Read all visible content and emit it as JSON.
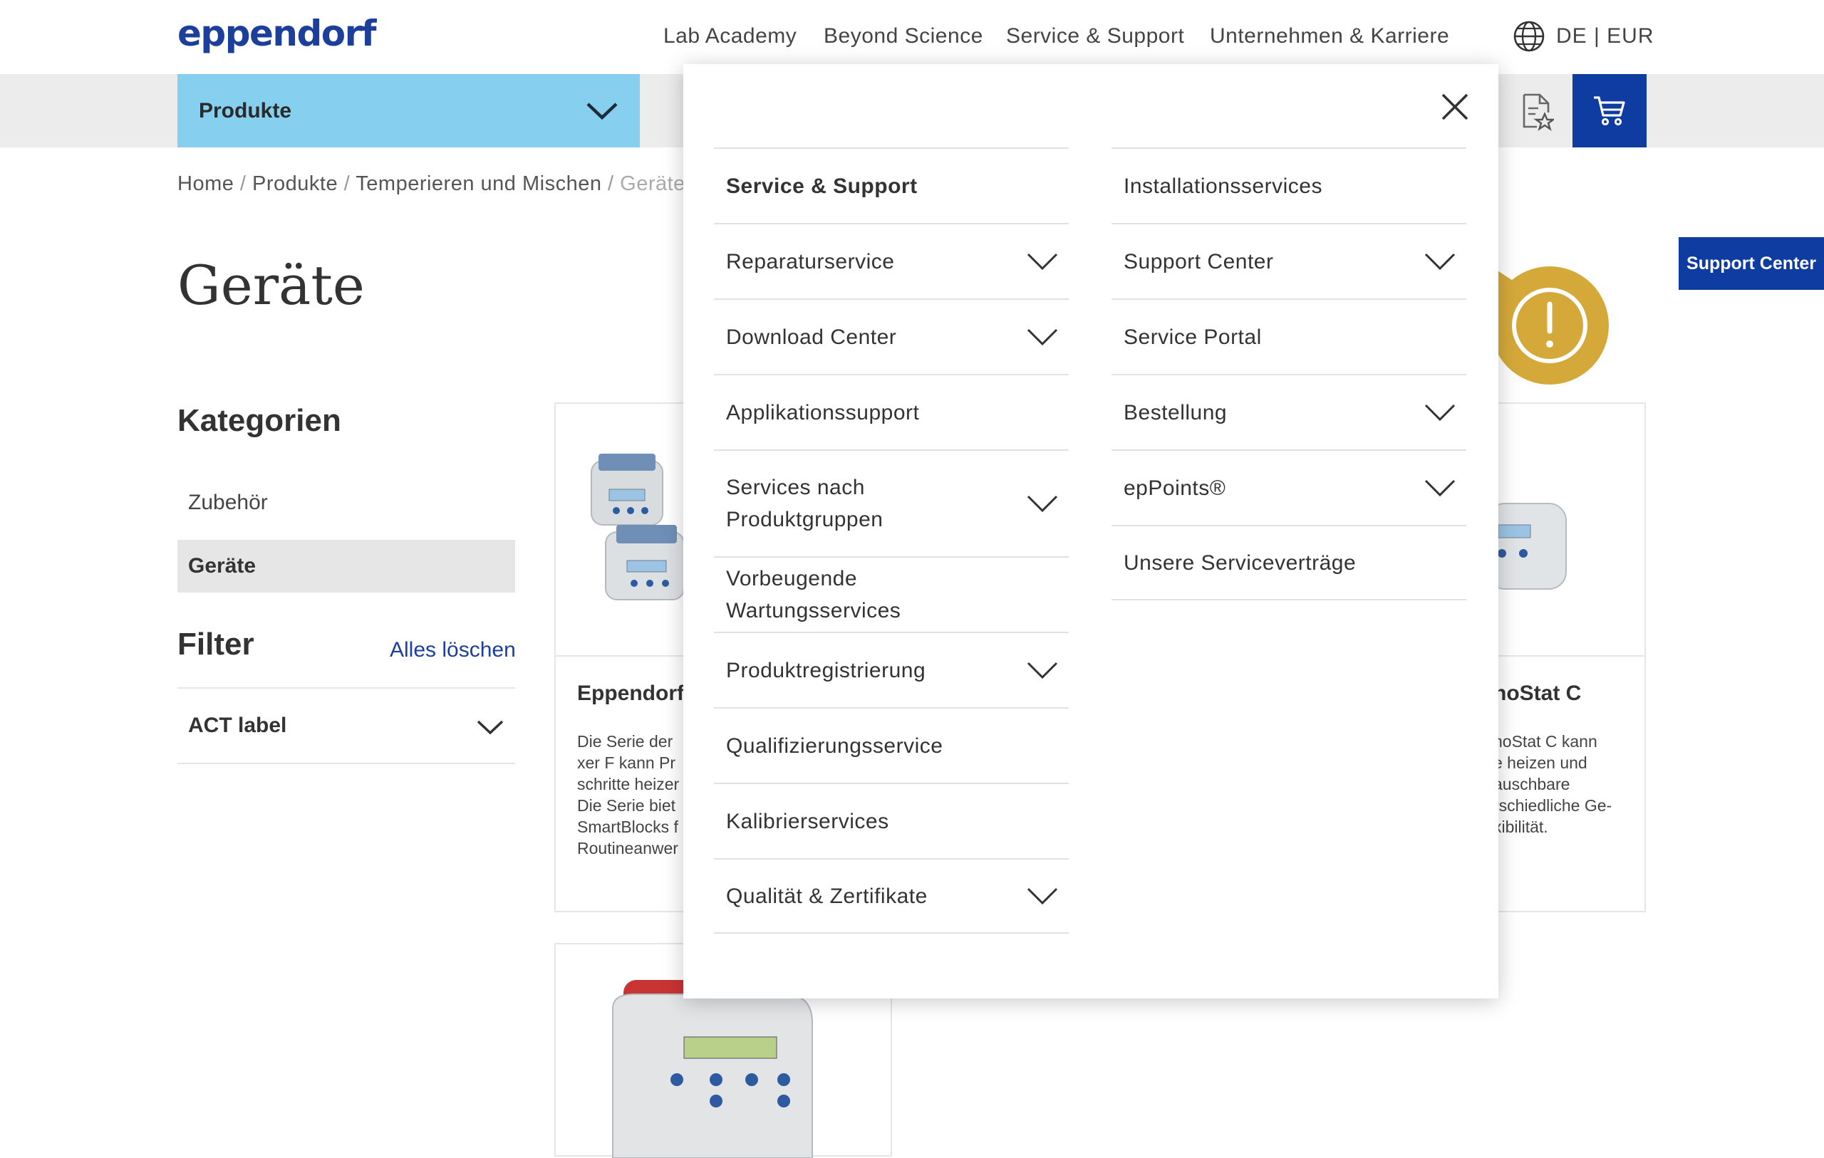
{
  "header": {
    "logo": "eppendorf",
    "nav": [
      "Lab Academy",
      "Beyond Science",
      "Service & Support",
      "Unternehmen & Karriere"
    ],
    "locale": "DE | EUR"
  },
  "toolbar": {
    "products_label": "Produkte"
  },
  "breadcrumb": [
    "Home",
    "Produkte",
    "Temperieren und Mischen",
    "Geräte"
  ],
  "page_title": "Geräte",
  "sidebar": {
    "categories_heading": "Kategorien",
    "categories": [
      {
        "label": "Zubehör",
        "active": false
      },
      {
        "label": "Geräte",
        "active": true
      }
    ],
    "filter_heading": "Filter",
    "clear_all": "Alles löschen",
    "filters": [
      {
        "label": "ACT label"
      }
    ]
  },
  "cards": [
    {
      "title": "Eppendorf",
      "desc": "Die Serie der\nxer F kann Pr\nschritte heizer\nDie Serie biet\nSmartBlocks f\nRoutineanwer"
    },
    {
      "title": "noStat C",
      "desc": "noStat C kann\ne heizen und\nauschbare\nrschiedliche Ge-\nxibilität."
    }
  ],
  "mega_menu": {
    "left_column": [
      {
        "label": "Service & Support",
        "bold": true,
        "expandable": false
      },
      {
        "label": "Reparaturservice",
        "expandable": true
      },
      {
        "label": "Download Center",
        "expandable": true
      },
      {
        "label": "Applikationssupport",
        "expandable": false
      },
      {
        "label": "Services nach Produktgruppen",
        "expandable": true
      },
      {
        "label": "Vorbeugende Wartungsservices",
        "expandable": false
      },
      {
        "label": "Produktregistrierung",
        "expandable": true
      },
      {
        "label": "Qualifizierungsservice",
        "expandable": false
      },
      {
        "label": "Kalibrierservices",
        "expandable": false
      },
      {
        "label": "Qualität & Zertifikate",
        "expandable": true
      }
    ],
    "right_column": [
      {
        "label": "Installationsservices",
        "expandable": false
      },
      {
        "label": "Support Center",
        "expandable": true
      },
      {
        "label": "Service Portal",
        "expandable": false
      },
      {
        "label": "Bestellung",
        "expandable": true
      },
      {
        "label": "epPoints®",
        "expandable": true
      },
      {
        "label": "Unsere Serviceverträge",
        "expandable": false
      }
    ]
  },
  "support_tab": "Support Center",
  "colors": {
    "brand_blue": "#0f3ca0",
    "products_bar": "#86cfee",
    "alert_bubble": "#d4a93a"
  },
  "icons": [
    "globe-icon",
    "chevron-down-icon",
    "document-star-icon",
    "cart-icon",
    "close-icon",
    "alert-icon"
  ]
}
